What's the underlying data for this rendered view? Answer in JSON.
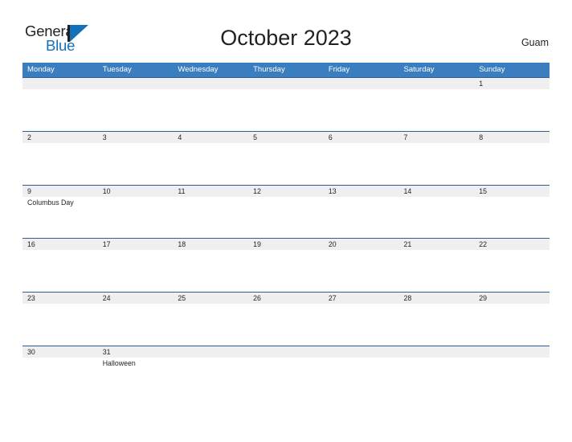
{
  "brand": {
    "name_part1": "General",
    "name_part2": "Blue",
    "color_dark": "#231f20",
    "color_blue": "#1271b8",
    "mark": "triangle-flag-icon"
  },
  "header": {
    "title": "October 2023",
    "region": "Guam"
  },
  "theme": {
    "header_blue": "#3a7ebf",
    "divider_blue": "#2a6099",
    "band_gray": "#efefef",
    "text": "#231f20"
  },
  "calendar": {
    "day_names": [
      "Monday",
      "Tuesday",
      "Wednesday",
      "Thursday",
      "Friday",
      "Saturday",
      "Sunday"
    ],
    "weeks": [
      [
        {
          "day": "",
          "event": ""
        },
        {
          "day": "",
          "event": ""
        },
        {
          "day": "",
          "event": ""
        },
        {
          "day": "",
          "event": ""
        },
        {
          "day": "",
          "event": ""
        },
        {
          "day": "",
          "event": ""
        },
        {
          "day": "1",
          "event": ""
        }
      ],
      [
        {
          "day": "2",
          "event": ""
        },
        {
          "day": "3",
          "event": ""
        },
        {
          "day": "4",
          "event": ""
        },
        {
          "day": "5",
          "event": ""
        },
        {
          "day": "6",
          "event": ""
        },
        {
          "day": "7",
          "event": ""
        },
        {
          "day": "8",
          "event": ""
        }
      ],
      [
        {
          "day": "9",
          "event": "Columbus Day"
        },
        {
          "day": "10",
          "event": ""
        },
        {
          "day": "11",
          "event": ""
        },
        {
          "day": "12",
          "event": ""
        },
        {
          "day": "13",
          "event": ""
        },
        {
          "day": "14",
          "event": ""
        },
        {
          "day": "15",
          "event": ""
        }
      ],
      [
        {
          "day": "16",
          "event": ""
        },
        {
          "day": "17",
          "event": ""
        },
        {
          "day": "18",
          "event": ""
        },
        {
          "day": "19",
          "event": ""
        },
        {
          "day": "20",
          "event": ""
        },
        {
          "day": "21",
          "event": ""
        },
        {
          "day": "22",
          "event": ""
        }
      ],
      [
        {
          "day": "23",
          "event": ""
        },
        {
          "day": "24",
          "event": ""
        },
        {
          "day": "25",
          "event": ""
        },
        {
          "day": "26",
          "event": ""
        },
        {
          "day": "27",
          "event": ""
        },
        {
          "day": "28",
          "event": ""
        },
        {
          "day": "29",
          "event": ""
        }
      ],
      [
        {
          "day": "30",
          "event": ""
        },
        {
          "day": "31",
          "event": "Halloween"
        },
        {
          "day": "",
          "event": ""
        },
        {
          "day": "",
          "event": ""
        },
        {
          "day": "",
          "event": ""
        },
        {
          "day": "",
          "event": ""
        },
        {
          "day": "",
          "event": ""
        }
      ]
    ]
  }
}
